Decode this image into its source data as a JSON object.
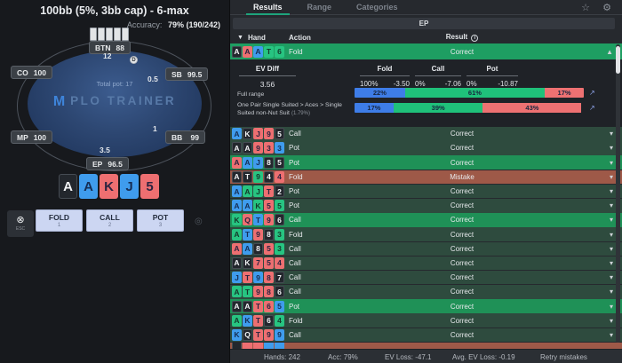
{
  "left_panel": {
    "title": "100bb (5%, 3bb cap) - 6-max",
    "accuracy_label": "Accuracy:",
    "accuracy_value": "79% (190/242)",
    "table": {
      "total_pot": "Total pot: 17",
      "logo_mark": "M",
      "logo_text": "PLO TRAINER",
      "dealer_button": "D",
      "seats": [
        {
          "pos": "BTN",
          "stack": "88"
        },
        {
          "pos": "CO",
          "stack": "100"
        },
        {
          "pos": "SB",
          "stack": "99.5"
        },
        {
          "pos": "MP",
          "stack": "100"
        },
        {
          "pos": "BB",
          "stack": "99"
        },
        {
          "pos": "EP",
          "stack": "96.5"
        }
      ],
      "bets": [
        {
          "seat": "BTN",
          "amount": "12"
        },
        {
          "seat": "SB",
          "amount": "0.5"
        },
        {
          "seat": "BB",
          "amount": "1"
        },
        {
          "seat": "EP",
          "amount": "3.5"
        }
      ]
    },
    "hero_cards": [
      [
        "A",
        "s"
      ],
      [
        "A",
        "d"
      ],
      [
        "K",
        "h"
      ],
      [
        "J",
        "d"
      ],
      [
        "5",
        "h"
      ]
    ],
    "esc_label": "ESC",
    "actions": [
      {
        "label": "FOLD",
        "key": "1"
      },
      {
        "label": "CALL",
        "key": "2"
      },
      {
        "label": "POT",
        "key": "3"
      }
    ]
  },
  "right_panel": {
    "tabs": [
      {
        "label": "Results",
        "active": true
      },
      {
        "label": "Range",
        "active": false
      },
      {
        "label": "Categories",
        "active": false
      }
    ],
    "position_header": "EP",
    "columns": {
      "hand": "Hand",
      "action": "Action",
      "result": "Result"
    },
    "expanded": {
      "cards": [
        [
          "A",
          "s"
        ],
        [
          "A",
          "h"
        ],
        [
          "A",
          "d"
        ],
        [
          "T",
          "c"
        ],
        [
          "6",
          "c"
        ]
      ],
      "action": "Fold",
      "result": "Correct",
      "ev_diff_label": "EV Diff",
      "ev_diff": "3.56",
      "action_evs": [
        {
          "name": "Fold",
          "freq": "100%",
          "ev": "-3.50"
        },
        {
          "name": "Call",
          "freq": "0%",
          "ev": "-7.06"
        },
        {
          "name": "Pot",
          "freq": "0%",
          "ev": "-10.87"
        }
      ],
      "ranges": [
        {
          "label": "Full range",
          "sub": "",
          "segments": [
            {
              "pct": "22%",
              "tone": "blue"
            },
            {
              "pct": "61%",
              "tone": "green"
            },
            {
              "pct": "17%",
              "tone": "red"
            }
          ]
        },
        {
          "label": "One Pair Single Suited > Aces > Single Suited non-Nut Suit",
          "sub": "(1.79%)",
          "segments": [
            {
              "pct": "17%",
              "tone": "blue"
            },
            {
              "pct": "39%",
              "tone": "green"
            },
            {
              "pct": "43%",
              "tone": "red"
            }
          ]
        }
      ]
    },
    "rows": [
      {
        "cards": [
          [
            "A",
            "d"
          ],
          [
            "K",
            "s"
          ],
          [
            "J",
            "h"
          ],
          [
            "9",
            "h"
          ],
          [
            "5",
            "s"
          ]
        ],
        "action": "Call",
        "result": "Correct",
        "tone": "dark"
      },
      {
        "cards": [
          [
            "A",
            "s"
          ],
          [
            "A",
            "s"
          ],
          [
            "9",
            "h"
          ],
          [
            "3",
            "h"
          ],
          [
            "3",
            "d"
          ]
        ],
        "action": "Pot",
        "result": "Correct",
        "tone": "dark"
      },
      {
        "cards": [
          [
            "A",
            "h"
          ],
          [
            "A",
            "d"
          ],
          [
            "J",
            "d"
          ],
          [
            "8",
            "s"
          ],
          [
            "5",
            "s"
          ]
        ],
        "action": "Pot",
        "result": "Correct",
        "tone": "bright"
      },
      {
        "cards": [
          [
            "A",
            "s"
          ],
          [
            "T",
            "s"
          ],
          [
            "9",
            "c"
          ],
          [
            "4",
            "s"
          ],
          [
            "4",
            "h"
          ]
        ],
        "action": "Fold",
        "result": "Mistake",
        "tone": "mistake"
      },
      {
        "cards": [
          [
            "A",
            "d"
          ],
          [
            "A",
            "c"
          ],
          [
            "J",
            "c"
          ],
          [
            "T",
            "h"
          ],
          [
            "2",
            "s"
          ]
        ],
        "action": "Pot",
        "result": "Correct",
        "tone": "dark"
      },
      {
        "cards": [
          [
            "A",
            "d"
          ],
          [
            "A",
            "d"
          ],
          [
            "K",
            "c"
          ],
          [
            "5",
            "h"
          ],
          [
            "5",
            "c"
          ]
        ],
        "action": "Pot",
        "result": "Correct",
        "tone": "dark"
      },
      {
        "cards": [
          [
            "K",
            "c"
          ],
          [
            "Q",
            "h"
          ],
          [
            "T",
            "d"
          ],
          [
            "9",
            "h"
          ],
          [
            "6",
            "s"
          ]
        ],
        "action": "Call",
        "result": "Correct",
        "tone": "bright"
      },
      {
        "cards": [
          [
            "A",
            "c"
          ],
          [
            "T",
            "d"
          ],
          [
            "9",
            "h"
          ],
          [
            "8",
            "s"
          ],
          [
            "3",
            "c"
          ]
        ],
        "action": "Fold",
        "result": "Correct",
        "tone": "dark"
      },
      {
        "cards": [
          [
            "A",
            "h"
          ],
          [
            "A",
            "d"
          ],
          [
            "8",
            "s"
          ],
          [
            "5",
            "h"
          ],
          [
            "3",
            "c"
          ]
        ],
        "action": "Call",
        "result": "Correct",
        "tone": "dark"
      },
      {
        "cards": [
          [
            "A",
            "s"
          ],
          [
            "K",
            "s"
          ],
          [
            "7",
            "h"
          ],
          [
            "5",
            "h"
          ],
          [
            "4",
            "h"
          ]
        ],
        "action": "Call",
        "result": "Correct",
        "tone": "dark"
      },
      {
        "cards": [
          [
            "J",
            "d"
          ],
          [
            "T",
            "h"
          ],
          [
            "9",
            "d"
          ],
          [
            "8",
            "h"
          ],
          [
            "7",
            "s"
          ]
        ],
        "action": "Call",
        "result": "Correct",
        "tone": "dark"
      },
      {
        "cards": [
          [
            "A",
            "c"
          ],
          [
            "T",
            "c"
          ],
          [
            "9",
            "h"
          ],
          [
            "8",
            "h"
          ],
          [
            "6",
            "s"
          ]
        ],
        "action": "Call",
        "result": "Correct",
        "tone": "dark"
      },
      {
        "cards": [
          [
            "A",
            "s"
          ],
          [
            "A",
            "s"
          ],
          [
            "T",
            "h"
          ],
          [
            "6",
            "h"
          ],
          [
            "5",
            "d"
          ]
        ],
        "action": "Pot",
        "result": "Correct",
        "tone": "bright"
      },
      {
        "cards": [
          [
            "A",
            "c"
          ],
          [
            "K",
            "d"
          ],
          [
            "T",
            "h"
          ],
          [
            "6",
            "s"
          ],
          [
            "4",
            "c"
          ]
        ],
        "action": "Fold",
        "result": "Correct",
        "tone": "dark"
      },
      {
        "cards": [
          [
            "K",
            "d"
          ],
          [
            "Q",
            "s"
          ],
          [
            "T",
            "h"
          ],
          [
            "9",
            "h"
          ],
          [
            "9",
            "d"
          ]
        ],
        "action": "Call",
        "result": "Correct",
        "tone": "dark"
      }
    ],
    "partial_row": {
      "tone": "mistake",
      "suits": [
        "s",
        "h",
        "h",
        "d",
        "d"
      ]
    },
    "footer": {
      "hands": "Hands: 242",
      "acc": "Acc: 79%",
      "ev_loss": "EV Loss: -47.1",
      "avg_ev_loss": "Avg. EV Loss: -0.19",
      "retry": "Retry mistakes"
    }
  },
  "colors": {
    "bar_blue": "#3e7de8",
    "bar_green": "#1fc17a",
    "bar_red": "#ee7172",
    "tab_accent": "#1ea47c",
    "correct_row": "#2e4b3e",
    "correct_row_bright": "#1f9157",
    "mistake_row": "#9e5948",
    "expanded_header": "#1e9e62"
  }
}
